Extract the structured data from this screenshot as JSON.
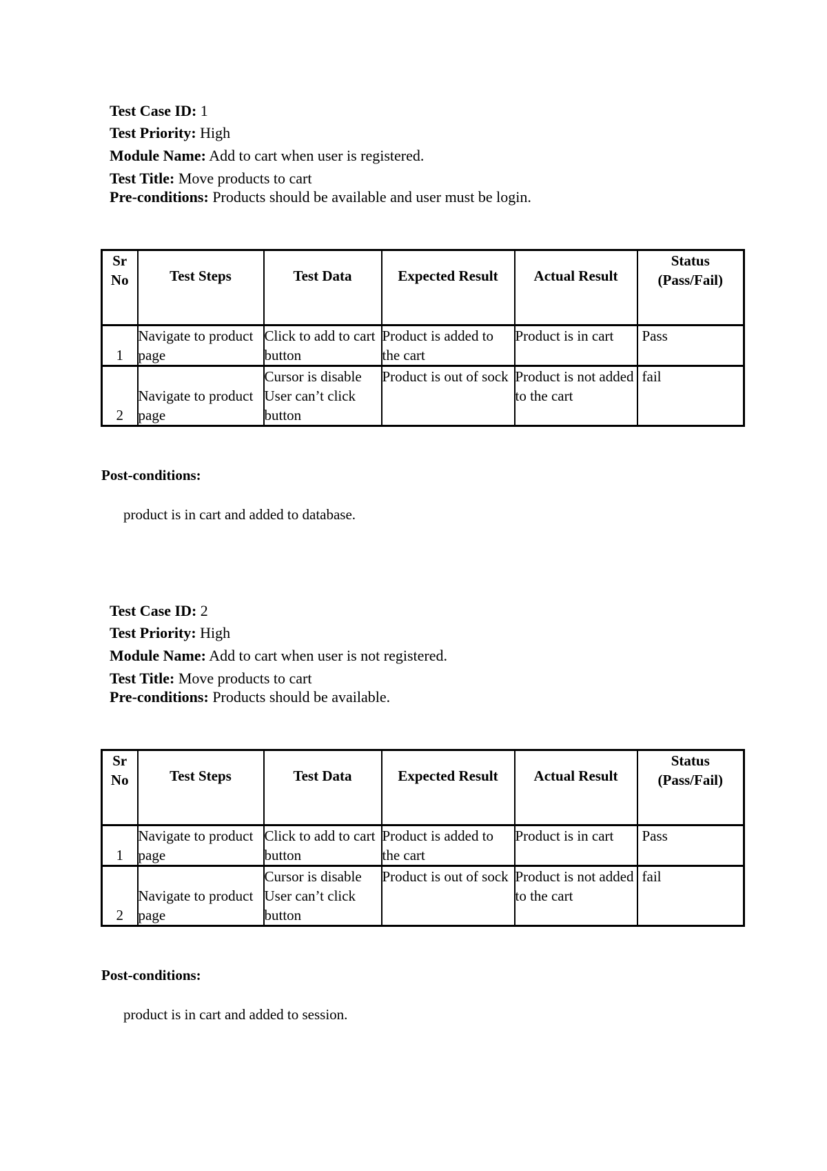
{
  "labels": {
    "id": "Test Case ID:",
    "priority": "Test Priority:",
    "module": "Module Name:",
    "title": "Test Title:",
    "pre": "Pre-conditions:",
    "post": "Post-conditions:"
  },
  "columns": [
    "Sr No",
    "Test Steps",
    "Test Data",
    "Expected Result",
    "Actual Result",
    "Status (Pass/Fail)"
  ],
  "columns_lines": {
    "sr1": "Sr",
    "sr2": "No",
    "status1": "Status",
    "status2": "(Pass/Fail)"
  },
  "cases": [
    {
      "id": "1",
      "priority": "High",
      "module": "Add to cart when user is registered.",
      "title": "Move products to cart",
      "pre": "Products should be available and user must be login.",
      "post": "product is in cart and added to database.",
      "rows": [
        {
          "sr": "1",
          "steps": "Navigate to product page",
          "data": "Click to add to cart button",
          "expected": "Product is added to the cart",
          "actual": "Product is in cart",
          "status": "Pass"
        },
        {
          "sr": "2",
          "steps": "Navigate to product page",
          "data": "Cursor is disable User can’t click button",
          "expected": "Product is out of sock",
          "actual": "Product is not added to the cart",
          "status": "fail"
        }
      ]
    },
    {
      "id": "2",
      "priority": "High",
      "module": "Add to cart when user is not registered.",
      "title": "Move products to cart",
      "pre": "Products should be available.",
      "post": "product is in cart and added to session.",
      "rows": [
        {
          "sr": "1",
          "steps": "Navigate to product page",
          "data": "Click to add to cart button",
          "expected": "Product is added to the cart",
          "actual": "Product is in cart",
          "status": "Pass"
        },
        {
          "sr": "2",
          "steps": "Navigate to product page",
          "data": "Cursor is disable User can’t click button",
          "expected": "Product is out of sock",
          "actual": "Product is not added to the cart",
          "status": "fail"
        }
      ]
    }
  ]
}
